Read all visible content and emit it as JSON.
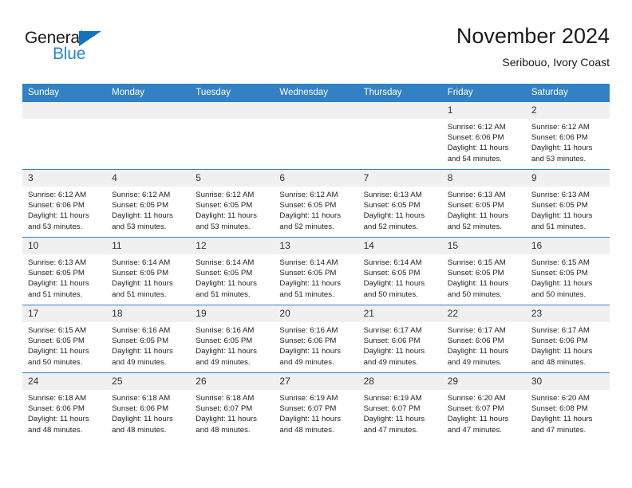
{
  "brand": {
    "name_part1": "General",
    "name_part2": "Blue",
    "logo_colors": {
      "text": "#1a1a1a",
      "blue": "#2b84c8",
      "triangle": "#1573ba"
    }
  },
  "header": {
    "title": "November 2024",
    "subtitle": "Seribouo, Ivory Coast"
  },
  "theme": {
    "header_bg": "#3281c4",
    "daynum_bg": "#f0f0f0",
    "cell_bg": "#ffffff"
  },
  "weekdays": [
    "Sunday",
    "Monday",
    "Tuesday",
    "Wednesday",
    "Thursday",
    "Friday",
    "Saturday"
  ],
  "weeks": [
    [
      {
        "day": "",
        "sunrise": "",
        "sunset": "",
        "daylight_line1": "",
        "daylight_line2": ""
      },
      {
        "day": "",
        "sunrise": "",
        "sunset": "",
        "daylight_line1": "",
        "daylight_line2": ""
      },
      {
        "day": "",
        "sunrise": "",
        "sunset": "",
        "daylight_line1": "",
        "daylight_line2": ""
      },
      {
        "day": "",
        "sunrise": "",
        "sunset": "",
        "daylight_line1": "",
        "daylight_line2": ""
      },
      {
        "day": "",
        "sunrise": "",
        "sunset": "",
        "daylight_line1": "",
        "daylight_line2": ""
      },
      {
        "day": "1",
        "sunrise": "Sunrise: 6:12 AM",
        "sunset": "Sunset: 6:06 PM",
        "daylight_line1": "Daylight: 11 hours",
        "daylight_line2": "and 54 minutes."
      },
      {
        "day": "2",
        "sunrise": "Sunrise: 6:12 AM",
        "sunset": "Sunset: 6:06 PM",
        "daylight_line1": "Daylight: 11 hours",
        "daylight_line2": "and 53 minutes."
      }
    ],
    [
      {
        "day": "3",
        "sunrise": "Sunrise: 6:12 AM",
        "sunset": "Sunset: 6:06 PM",
        "daylight_line1": "Daylight: 11 hours",
        "daylight_line2": "and 53 minutes."
      },
      {
        "day": "4",
        "sunrise": "Sunrise: 6:12 AM",
        "sunset": "Sunset: 6:05 PM",
        "daylight_line1": "Daylight: 11 hours",
        "daylight_line2": "and 53 minutes."
      },
      {
        "day": "5",
        "sunrise": "Sunrise: 6:12 AM",
        "sunset": "Sunset: 6:05 PM",
        "daylight_line1": "Daylight: 11 hours",
        "daylight_line2": "and 53 minutes."
      },
      {
        "day": "6",
        "sunrise": "Sunrise: 6:12 AM",
        "sunset": "Sunset: 6:05 PM",
        "daylight_line1": "Daylight: 11 hours",
        "daylight_line2": "and 52 minutes."
      },
      {
        "day": "7",
        "sunrise": "Sunrise: 6:13 AM",
        "sunset": "Sunset: 6:05 PM",
        "daylight_line1": "Daylight: 11 hours",
        "daylight_line2": "and 52 minutes."
      },
      {
        "day": "8",
        "sunrise": "Sunrise: 6:13 AM",
        "sunset": "Sunset: 6:05 PM",
        "daylight_line1": "Daylight: 11 hours",
        "daylight_line2": "and 52 minutes."
      },
      {
        "day": "9",
        "sunrise": "Sunrise: 6:13 AM",
        "sunset": "Sunset: 6:05 PM",
        "daylight_line1": "Daylight: 11 hours",
        "daylight_line2": "and 51 minutes."
      }
    ],
    [
      {
        "day": "10",
        "sunrise": "Sunrise: 6:13 AM",
        "sunset": "Sunset: 6:05 PM",
        "daylight_line1": "Daylight: 11 hours",
        "daylight_line2": "and 51 minutes."
      },
      {
        "day": "11",
        "sunrise": "Sunrise: 6:14 AM",
        "sunset": "Sunset: 6:05 PM",
        "daylight_line1": "Daylight: 11 hours",
        "daylight_line2": "and 51 minutes."
      },
      {
        "day": "12",
        "sunrise": "Sunrise: 6:14 AM",
        "sunset": "Sunset: 6:05 PM",
        "daylight_line1": "Daylight: 11 hours",
        "daylight_line2": "and 51 minutes."
      },
      {
        "day": "13",
        "sunrise": "Sunrise: 6:14 AM",
        "sunset": "Sunset: 6:05 PM",
        "daylight_line1": "Daylight: 11 hours",
        "daylight_line2": "and 51 minutes."
      },
      {
        "day": "14",
        "sunrise": "Sunrise: 6:14 AM",
        "sunset": "Sunset: 6:05 PM",
        "daylight_line1": "Daylight: 11 hours",
        "daylight_line2": "and 50 minutes."
      },
      {
        "day": "15",
        "sunrise": "Sunrise: 6:15 AM",
        "sunset": "Sunset: 6:05 PM",
        "daylight_line1": "Daylight: 11 hours",
        "daylight_line2": "and 50 minutes."
      },
      {
        "day": "16",
        "sunrise": "Sunrise: 6:15 AM",
        "sunset": "Sunset: 6:05 PM",
        "daylight_line1": "Daylight: 11 hours",
        "daylight_line2": "and 50 minutes."
      }
    ],
    [
      {
        "day": "17",
        "sunrise": "Sunrise: 6:15 AM",
        "sunset": "Sunset: 6:05 PM",
        "daylight_line1": "Daylight: 11 hours",
        "daylight_line2": "and 50 minutes."
      },
      {
        "day": "18",
        "sunrise": "Sunrise: 6:16 AM",
        "sunset": "Sunset: 6:05 PM",
        "daylight_line1": "Daylight: 11 hours",
        "daylight_line2": "and 49 minutes."
      },
      {
        "day": "19",
        "sunrise": "Sunrise: 6:16 AM",
        "sunset": "Sunset: 6:05 PM",
        "daylight_line1": "Daylight: 11 hours",
        "daylight_line2": "and 49 minutes."
      },
      {
        "day": "20",
        "sunrise": "Sunrise: 6:16 AM",
        "sunset": "Sunset: 6:06 PM",
        "daylight_line1": "Daylight: 11 hours",
        "daylight_line2": "and 49 minutes."
      },
      {
        "day": "21",
        "sunrise": "Sunrise: 6:17 AM",
        "sunset": "Sunset: 6:06 PM",
        "daylight_line1": "Daylight: 11 hours",
        "daylight_line2": "and 49 minutes."
      },
      {
        "day": "22",
        "sunrise": "Sunrise: 6:17 AM",
        "sunset": "Sunset: 6:06 PM",
        "daylight_line1": "Daylight: 11 hours",
        "daylight_line2": "and 49 minutes."
      },
      {
        "day": "23",
        "sunrise": "Sunrise: 6:17 AM",
        "sunset": "Sunset: 6:06 PM",
        "daylight_line1": "Daylight: 11 hours",
        "daylight_line2": "and 48 minutes."
      }
    ],
    [
      {
        "day": "24",
        "sunrise": "Sunrise: 6:18 AM",
        "sunset": "Sunset: 6:06 PM",
        "daylight_line1": "Daylight: 11 hours",
        "daylight_line2": "and 48 minutes."
      },
      {
        "day": "25",
        "sunrise": "Sunrise: 6:18 AM",
        "sunset": "Sunset: 6:06 PM",
        "daylight_line1": "Daylight: 11 hours",
        "daylight_line2": "and 48 minutes."
      },
      {
        "day": "26",
        "sunrise": "Sunrise: 6:18 AM",
        "sunset": "Sunset: 6:07 PM",
        "daylight_line1": "Daylight: 11 hours",
        "daylight_line2": "and 48 minutes."
      },
      {
        "day": "27",
        "sunrise": "Sunrise: 6:19 AM",
        "sunset": "Sunset: 6:07 PM",
        "daylight_line1": "Daylight: 11 hours",
        "daylight_line2": "and 48 minutes."
      },
      {
        "day": "28",
        "sunrise": "Sunrise: 6:19 AM",
        "sunset": "Sunset: 6:07 PM",
        "daylight_line1": "Daylight: 11 hours",
        "daylight_line2": "and 47 minutes."
      },
      {
        "day": "29",
        "sunrise": "Sunrise: 6:20 AM",
        "sunset": "Sunset: 6:07 PM",
        "daylight_line1": "Daylight: 11 hours",
        "daylight_line2": "and 47 minutes."
      },
      {
        "day": "30",
        "sunrise": "Sunrise: 6:20 AM",
        "sunset": "Sunset: 6:08 PM",
        "daylight_line1": "Daylight: 11 hours",
        "daylight_line2": "and 47 minutes."
      }
    ]
  ]
}
